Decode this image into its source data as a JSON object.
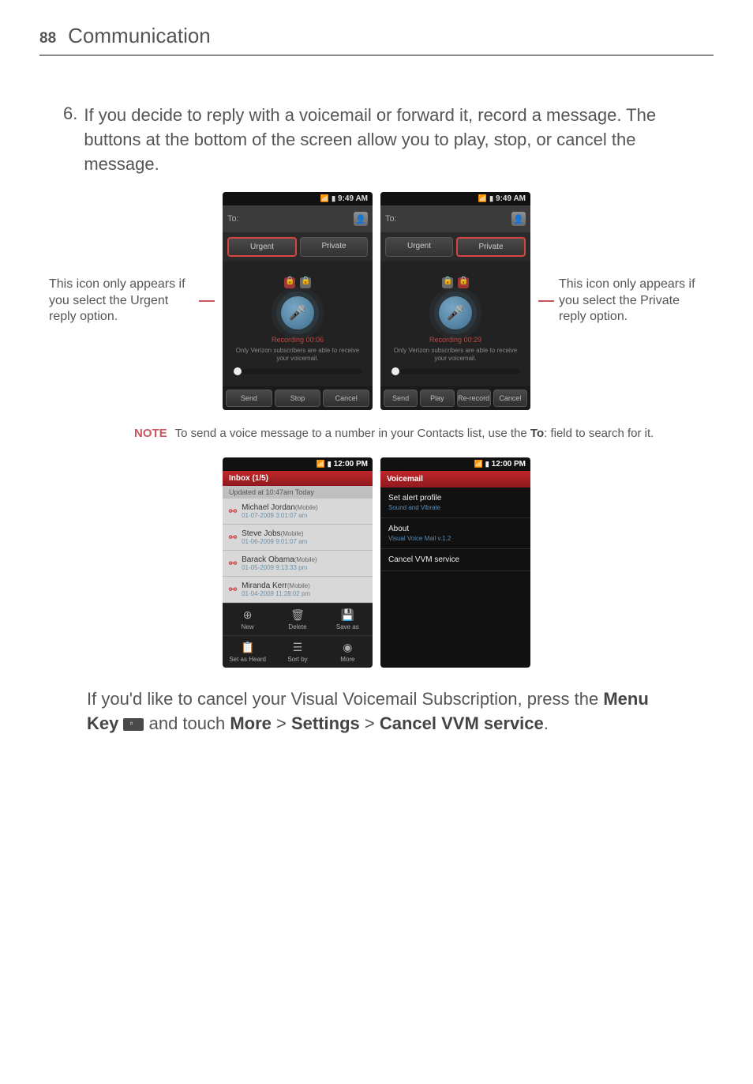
{
  "header": {
    "page": "88",
    "chapter": "Communication"
  },
  "step": {
    "num": "6.",
    "text": "If you decide to reply with a voicemail or forward it, record a message. The buttons at the bottom of the screen allow you to play, stop, or cancel the message."
  },
  "callout_left": "This icon only appears if you select the Urgent reply option.",
  "callout_right": "This icon only appears if you select the Private reply option.",
  "shot1": {
    "time": "9:49 AM",
    "to": "To:",
    "urgent": "Urgent",
    "private": "Private",
    "rec_label": "Recording 00:06",
    "sub_only": "Only Verizon subscribers are able to receive your voicemail.",
    "btns": [
      "Send",
      "Stop",
      "Cancel"
    ]
  },
  "shot2": {
    "time": "9:49 AM",
    "to": "To:",
    "urgent": "Urgent",
    "private": "Private",
    "rec_label": "Recording 00:29",
    "sub_only": "Only Verizon subscribers are able to receive your voicemail.",
    "btns": [
      "Send",
      "Play",
      "Re-record",
      "Cancel"
    ]
  },
  "note": {
    "label": "NOTE",
    "text_a": "To send a voice message to a number in your Contacts list, use the ",
    "to_bold": "To",
    "text_b": ": field to search for it."
  },
  "inbox": {
    "time": "12:00 PM",
    "hdr": "Inbox (1/5)",
    "updated": "Updated at 10:47am Today",
    "items": [
      {
        "name": "Michael Jordan",
        "type": "(Mobile)",
        "date": "01-07-2009 3:01:07 am"
      },
      {
        "name": "Steve Jobs",
        "type": "(Mobile)",
        "date": "01-06-2009 9:01:07 am"
      },
      {
        "name": "Barack Obama",
        "type": "(Mobile)",
        "date": "01-05-2009 9:13:33 pm"
      },
      {
        "name": "Miranda Kerr",
        "type": "(Mobile)",
        "date": "01-04-2009 11:28:02 pm"
      }
    ],
    "footer": [
      "New",
      "Delete",
      "Save as",
      "Set as Heard",
      "Sort by",
      "More"
    ]
  },
  "settings": {
    "time": "12:00 PM",
    "hdr": "Voicemail",
    "items": [
      {
        "title": "Set alert profile",
        "sub": "Sound and Vibrate"
      },
      {
        "title": "About",
        "sub": "Visual Voice Mail v.1.2"
      },
      {
        "title": "Cancel VVM service",
        "sub": ""
      }
    ]
  },
  "closing": {
    "a": "If you'd like to cancel your Visual Voicemail Subscription, press the ",
    "menu_key": "Menu Key",
    "b": " and touch ",
    "more": "More",
    "gt1": " > ",
    "settings": "Settings",
    "gt2": " > ",
    "cancel": "Cancel VVM service",
    "dot": "."
  }
}
